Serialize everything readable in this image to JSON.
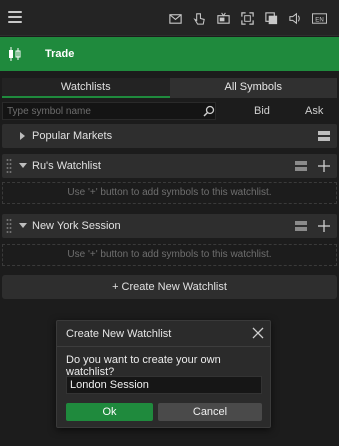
{
  "topbar": {
    "menu_icon": "hamburger-menu-icon",
    "icons": [
      "mail-icon",
      "touch-hand-icon",
      "news-tv-icon",
      "fullscreen-icon",
      "windows-icon",
      "sound-icon",
      "language-en-icon"
    ],
    "language_label": "EN"
  },
  "trade_bar": {
    "label": "Trade",
    "icon": "candlestick-icon",
    "color": "#1f8a3d"
  },
  "tabs": [
    {
      "label": "Watchlists",
      "active": true
    },
    {
      "label": "All Symbols",
      "active": false
    }
  ],
  "search": {
    "placeholder": "Type symbol name",
    "value": ""
  },
  "columns": {
    "bid": "Bid",
    "ask": "Ask"
  },
  "groups": [
    {
      "label": "Popular Markets",
      "expanded": false
    },
    {
      "label": "Ru's Watchlist",
      "expanded": true,
      "empty_text": "Use '+' button to add symbols to this watchlist."
    },
    {
      "label": "New York Session",
      "expanded": true,
      "empty_text": "Use '+' button to add symbols to this watchlist."
    }
  ],
  "create_button": {
    "label": "+ Create New Watchlist"
  },
  "dialog": {
    "title": "Create New Watchlist",
    "question": "Do you want to create your own watchlist?",
    "input_value": "London Session",
    "ok_label": "Ok",
    "cancel_label": "Cancel"
  }
}
